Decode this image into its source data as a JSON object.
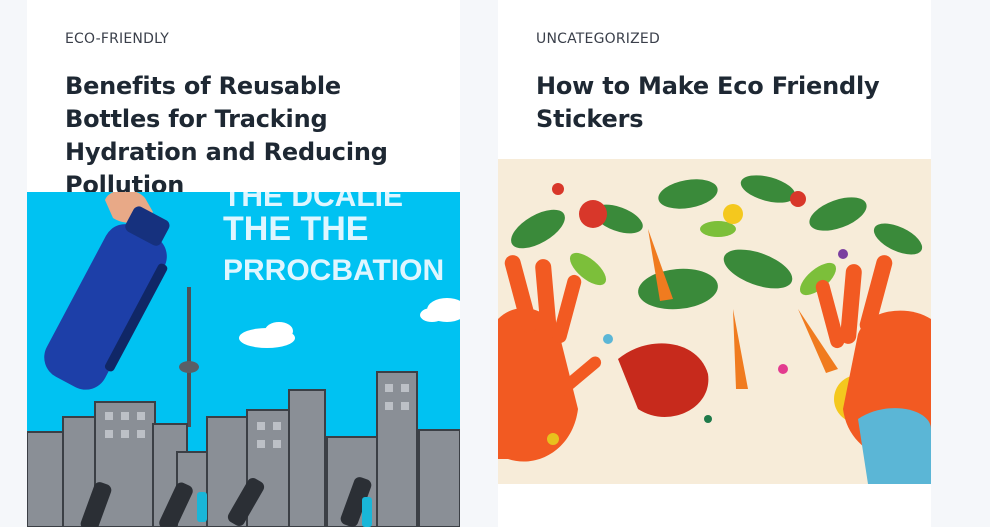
{
  "posts": [
    {
      "category": "ECO-FRIENDLY",
      "title": "Benefits of Reusable Bottles for Tracking Hydration and Reducing Pollution",
      "image": {
        "alt": "Illustration of a blue reusable bottle above a city skyline",
        "overlay_line1": "THE DCALIE",
        "overlay_line2": "THE THE",
        "overlay_line3": "PRROCBATION",
        "colors": {
          "sky": "#00c2f2",
          "bottle": "#1d3fa8",
          "buildings": "#8a8f96"
        }
      }
    },
    {
      "category": "UNCATEGORIZED",
      "title": "How to Make Eco Friendly Stickers",
      "image": {
        "alt": "Colorful collage of vegetables and leaves between two painted hands",
        "colors": {
          "background": "#f7ecd9",
          "hand": "#f25a22",
          "leaf": "#3a8a3a"
        }
      }
    }
  ]
}
